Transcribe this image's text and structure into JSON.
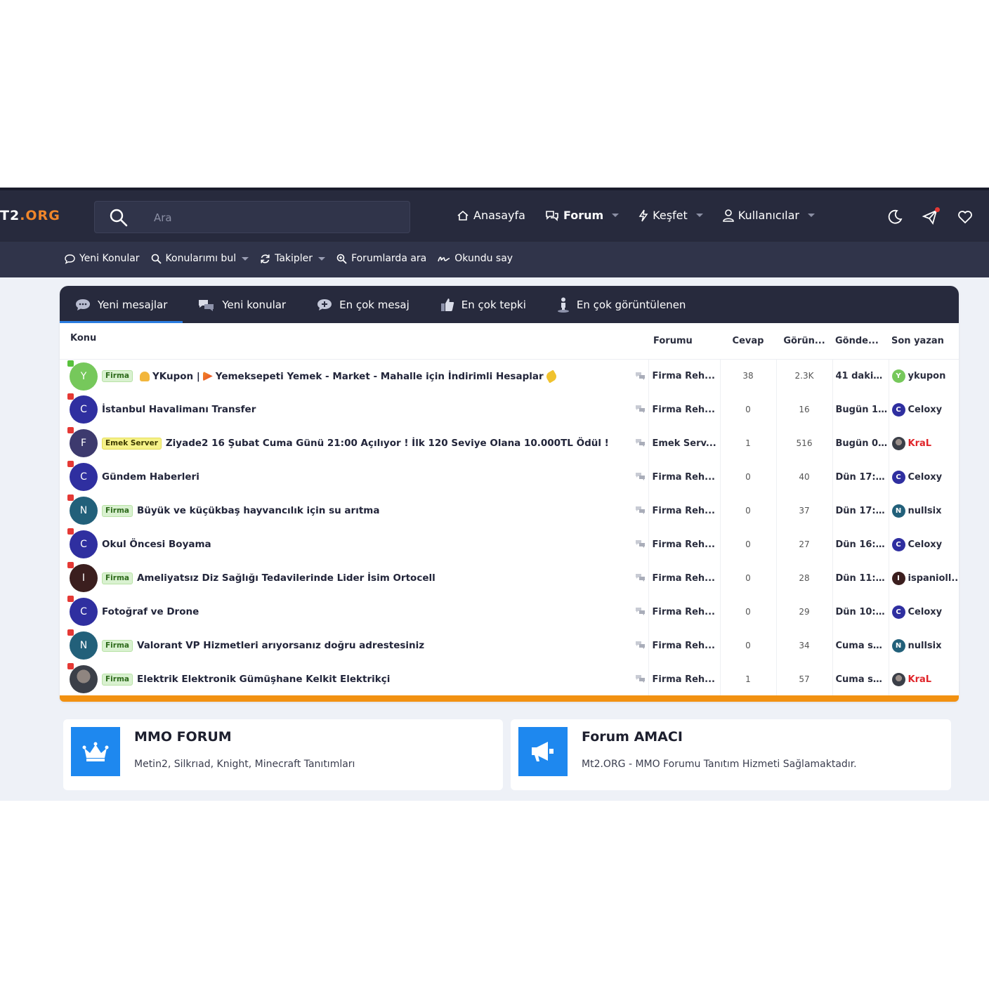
{
  "header": {
    "logo_main": "T2",
    "logo_accent": ".ORG",
    "search_placeholder": "Ara",
    "nav": [
      {
        "label": "Anasayfa",
        "icon": "home-icon"
      },
      {
        "label": "Forum",
        "icon": "chat-icon"
      },
      {
        "label": "Keşfet",
        "icon": "bolt-icon"
      },
      {
        "label": "Kullanıcılar",
        "icon": "user-icon"
      }
    ],
    "right_icons": [
      "moon-icon",
      "send-icon",
      "heart-icon"
    ]
  },
  "subnav": [
    {
      "label": "Yeni Konular",
      "icon": "comment-icon"
    },
    {
      "label": "Konularımı bul",
      "icon": "search-icon"
    },
    {
      "label": "Takipler",
      "icon": "refresh-icon"
    },
    {
      "label": "Forumlarda ara",
      "icon": "zoom-icon"
    },
    {
      "label": "Okundu say",
      "icon": "signature-icon"
    }
  ],
  "tabs": [
    {
      "label": "Yeni mesajlar",
      "icon": "speech-icon"
    },
    {
      "label": "Yeni konular",
      "icon": "chats-icon"
    },
    {
      "label": "En çok mesaj",
      "icon": "plus-bubble-icon"
    },
    {
      "label": "En çok tepki",
      "icon": "thumbs-up-icon"
    },
    {
      "label": "En çok görüntülenen",
      "icon": "person-icon"
    }
  ],
  "table": {
    "columns": {
      "konu": "Konu",
      "forumu": "Forumu",
      "cevap": "Cevap",
      "gorun": "Görün...",
      "gonde": "Gönde...",
      "son": "Son yazan"
    },
    "rows": [
      {
        "letter": "Y",
        "avatar_color": "#76c85b",
        "status": "green",
        "prefix": "Firma",
        "title_a": "YKupon |",
        "title_b": "Yemeksepeti Yemek - Market - Mahalle için İndirimli Hesaplar",
        "forum": "Firma Reh...",
        "replies": "38",
        "views": "2.3K",
        "date": "41 dakik...",
        "last": "ykupon",
        "last_color": "#76c85b",
        "last_red": false
      },
      {
        "letter": "C",
        "avatar_color": "#2f2fa0",
        "status": "red",
        "prefix": "",
        "title_a": "İstanbul Havalimanı Transfer",
        "title_b": "",
        "forum": "Firma Reh...",
        "replies": "0",
        "views": "16",
        "date": "Bugün 1...",
        "last": "Celoxy",
        "last_color": "#2f2fa0",
        "last_red": false
      },
      {
        "letter": "F",
        "avatar_color": "#3d3a6e",
        "status": "red",
        "prefix": "Emek Server",
        "title_a": "Ziyade2 16 Şubat Cuma Günü 21:00 Açılıyor ! İlk 120 Seviye Olana 10.000TL Ödül !",
        "title_b": "",
        "forum": "Emek Serv...",
        "replies": "1",
        "views": "516",
        "date": "Bugün 0...",
        "last": "KraL",
        "last_color": "#4a4f63",
        "last_red": true
      },
      {
        "letter": "C",
        "avatar_color": "#2f2fa0",
        "status": "red",
        "prefix": "",
        "title_a": "Gündem Haberleri",
        "title_b": "",
        "forum": "Firma Reh...",
        "replies": "0",
        "views": "40",
        "date": "Dün 17:2...",
        "last": "Celoxy",
        "last_color": "#2f2fa0",
        "last_red": false
      },
      {
        "letter": "N",
        "avatar_color": "#22607a",
        "status": "red",
        "prefix": "Firma",
        "title_a": "Büyük ve küçükbaş hayvancılık için su arıtma",
        "title_b": "",
        "forum": "Firma Reh...",
        "replies": "0",
        "views": "37",
        "date": "Dün 17:11...",
        "last": "nullsix",
        "last_color": "#22607a",
        "last_red": false
      },
      {
        "letter": "C",
        "avatar_color": "#2f2fa0",
        "status": "red",
        "prefix": "",
        "title_a": "Okul Öncesi Boyama",
        "title_b": "",
        "forum": "Firma Reh...",
        "replies": "0",
        "views": "27",
        "date": "Dün 16:3...",
        "last": "Celoxy",
        "last_color": "#2f2fa0",
        "last_red": false
      },
      {
        "letter": "I",
        "avatar_color": "#3b1e1e",
        "status": "red",
        "prefix": "Firma",
        "title_a": "Ameliyatsız Diz Sağlığı Tedavilerinde Lider İsim Ortocell",
        "title_b": "",
        "forum": "Firma Reh...",
        "replies": "0",
        "views": "28",
        "date": "Dün 11:4...",
        "last": "ispanioll...",
        "last_color": "#3b1e1e",
        "last_red": false
      },
      {
        "letter": "C",
        "avatar_color": "#2f2fa0",
        "status": "red",
        "prefix": "",
        "title_a": "Fotoğraf ve Drone",
        "title_b": "",
        "forum": "Firma Reh...",
        "replies": "0",
        "views": "29",
        "date": "Dün 10:0...",
        "last": "Celoxy",
        "last_color": "#2f2fa0",
        "last_red": false
      },
      {
        "letter": "N",
        "avatar_color": "#22607a",
        "status": "red",
        "prefix": "Firma",
        "title_a": "Valorant VP Hizmetleri arıyorsanız doğru adrestesiniz",
        "title_b": "",
        "forum": "Firma Reh...",
        "replies": "0",
        "views": "34",
        "date": "Cuma sa...",
        "last": "nullsix",
        "last_color": "#22607a",
        "last_red": false
      },
      {
        "letter": "",
        "avatar_color": "photo",
        "status": "red",
        "prefix": "Firma",
        "title_a": "Elektrik Elektronik Gümüşhane Kelkit Elektrikçi",
        "title_b": "",
        "forum": "Firma Reh...",
        "replies": "1",
        "views": "57",
        "date": "Cuma sa...",
        "last": "KraL",
        "last_color": "#4a4f63",
        "last_red": true
      }
    ]
  },
  "cards": [
    {
      "title": "MMO FORUM",
      "desc": "Metin2, Silkrıad, Knight, Minecraft Tanıtımları",
      "icon": "crown-icon"
    },
    {
      "title": "Forum AMACI",
      "desc": "Mt2.ORG - MMO Forumu Tanıtım Hizmeti Sağlamaktadır.",
      "icon": "megaphone-icon"
    }
  ],
  "colors": {
    "header": "#272a3d",
    "subnav": "#30344a",
    "accent_orange": "#f29111",
    "card_blue": "#1e88ef",
    "logo_orange": "#f0862a"
  }
}
